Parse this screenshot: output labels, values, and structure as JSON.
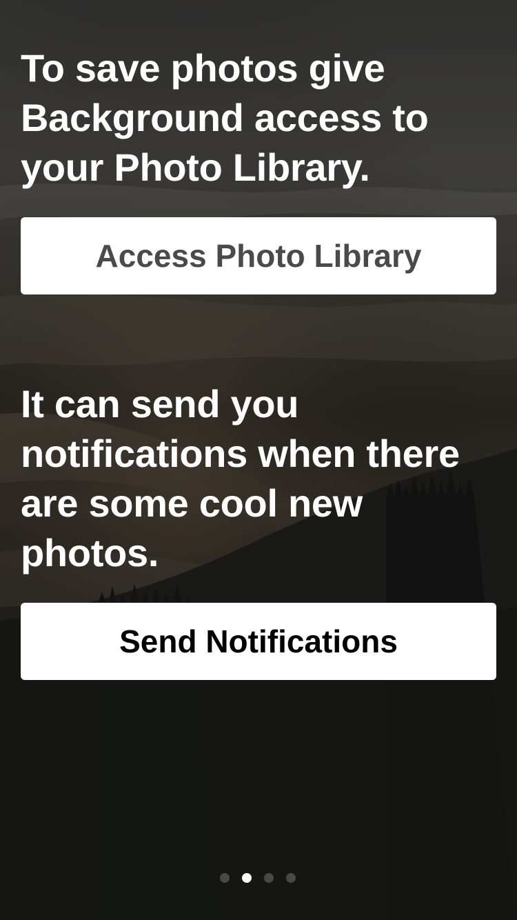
{
  "onboarding": {
    "photo_prompt": "To save photos give Background access to your Photo Library.",
    "photo_button_label": "Access Photo Library",
    "notify_prompt": "It can send you notifications when there are some cool new photos.",
    "notify_button_label": "Send Notifications"
  },
  "pager": {
    "page_count": 4,
    "active_index": 1
  },
  "colors": {
    "button_bg": "#ffffff",
    "headline_text": "#ffffff",
    "photo_button_text": "#4a4a4a",
    "notify_button_text": "#000000",
    "dot_active": "#ffffff",
    "dot_inactive": "rgba(255,255,255,0.22)"
  },
  "background_image": {
    "icon": "foggy-forested-hills-photo"
  }
}
